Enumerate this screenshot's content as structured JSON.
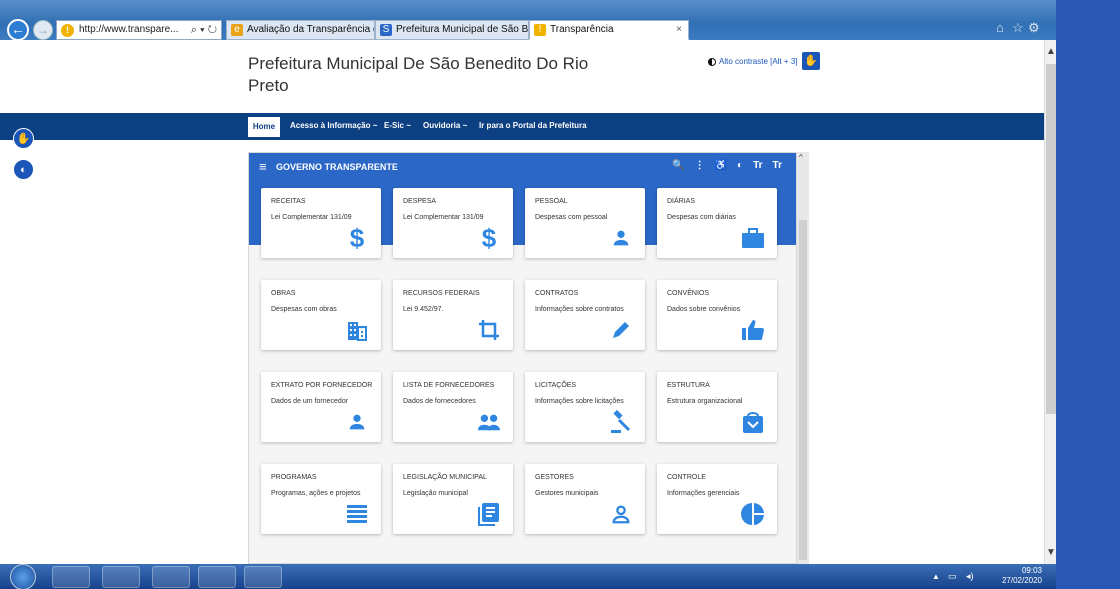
{
  "browser": {
    "address": "http://www.transpare...",
    "address_controls": "⌕ ▾ ↻",
    "tabs": [
      {
        "label": "Avaliação da Transparência do...",
        "color": "#e8a317",
        "icon": "ie-icon"
      },
      {
        "label": "Prefeitura Municipal de São Be...",
        "color": "#2a67c6",
        "icon": "s-icon"
      },
      {
        "label": "Transparência",
        "color": "#f0b400",
        "icon": "info-icon"
      }
    ]
  },
  "site": {
    "title": "Prefeitura Municipal De São Benedito Do Rio Preto",
    "contrast_label": "Alto contraste [Alt + 3]"
  },
  "nav": {
    "home": "Home",
    "items": [
      "Acesso à Informação ~",
      "E-Sic ~",
      "Ouvidoria ~",
      "Ir para o Portal da Prefeitura"
    ]
  },
  "panel": {
    "title": "GOVERNO TRANSPARENTE",
    "tools": [
      "🔍",
      "⋮",
      "♿",
      "◐",
      "Tr",
      "Tr"
    ]
  },
  "cards": [
    {
      "title": "RECEITAS",
      "subtitle": "Lei Complementar 131/09",
      "icon": "dollar-icon"
    },
    {
      "title": "DESPESA",
      "subtitle": "Lei Complementar 131/09",
      "icon": "dollar-icon"
    },
    {
      "title": "PESSOAL",
      "subtitle": "Despesas com pessoal",
      "icon": "person-icon"
    },
    {
      "title": "DIÁRIAS",
      "subtitle": "Despesas com diárias",
      "icon": "briefcase-icon"
    },
    {
      "title": "OBRAS",
      "subtitle": "Despesas com obras",
      "icon": "building-icon"
    },
    {
      "title": "RECURSOS FEDERAIS",
      "subtitle": "Lei 9.452/97.",
      "icon": "crop-icon"
    },
    {
      "title": "CONTRATOS",
      "subtitle": "Informações sobre contratos",
      "icon": "pencil-icon"
    },
    {
      "title": "CONVÊNIOS",
      "subtitle": "Dados sobre convênios",
      "icon": "thumbs-up-icon"
    },
    {
      "title": "EXTRATO POR FORNECEDOR",
      "subtitle": "Dados de um fornecedor",
      "icon": "person-icon"
    },
    {
      "title": "LISTA DE FORNECEDORES",
      "subtitle": "Dados de fornecedores",
      "icon": "people-icon"
    },
    {
      "title": "LICITAÇÕES",
      "subtitle": "Informações sobre licitações",
      "icon": "gavel-icon"
    },
    {
      "title": "ESTRUTURA",
      "subtitle": "Estrutura organizacional",
      "icon": "org-bag-icon"
    },
    {
      "title": "PROGRAMAS",
      "subtitle": "Programas, ações e projetos",
      "icon": "list-icon"
    },
    {
      "title": "LEGISLAÇÃO MUNICIPAL",
      "subtitle": "Legislação municipal",
      "icon": "document-icon"
    },
    {
      "title": "GESTORES",
      "subtitle": "Gestores municipais",
      "icon": "person-outline-icon"
    },
    {
      "title": "CONTROLE",
      "subtitle": "Informações gerenciais",
      "icon": "pie-chart-icon"
    }
  ],
  "colors": {
    "navbar": "#0d3f83",
    "panel": "#2a67c6",
    "icon": "#2f86e0"
  },
  "taskbar": {
    "time": "09:03",
    "date": "27/02/2020"
  }
}
